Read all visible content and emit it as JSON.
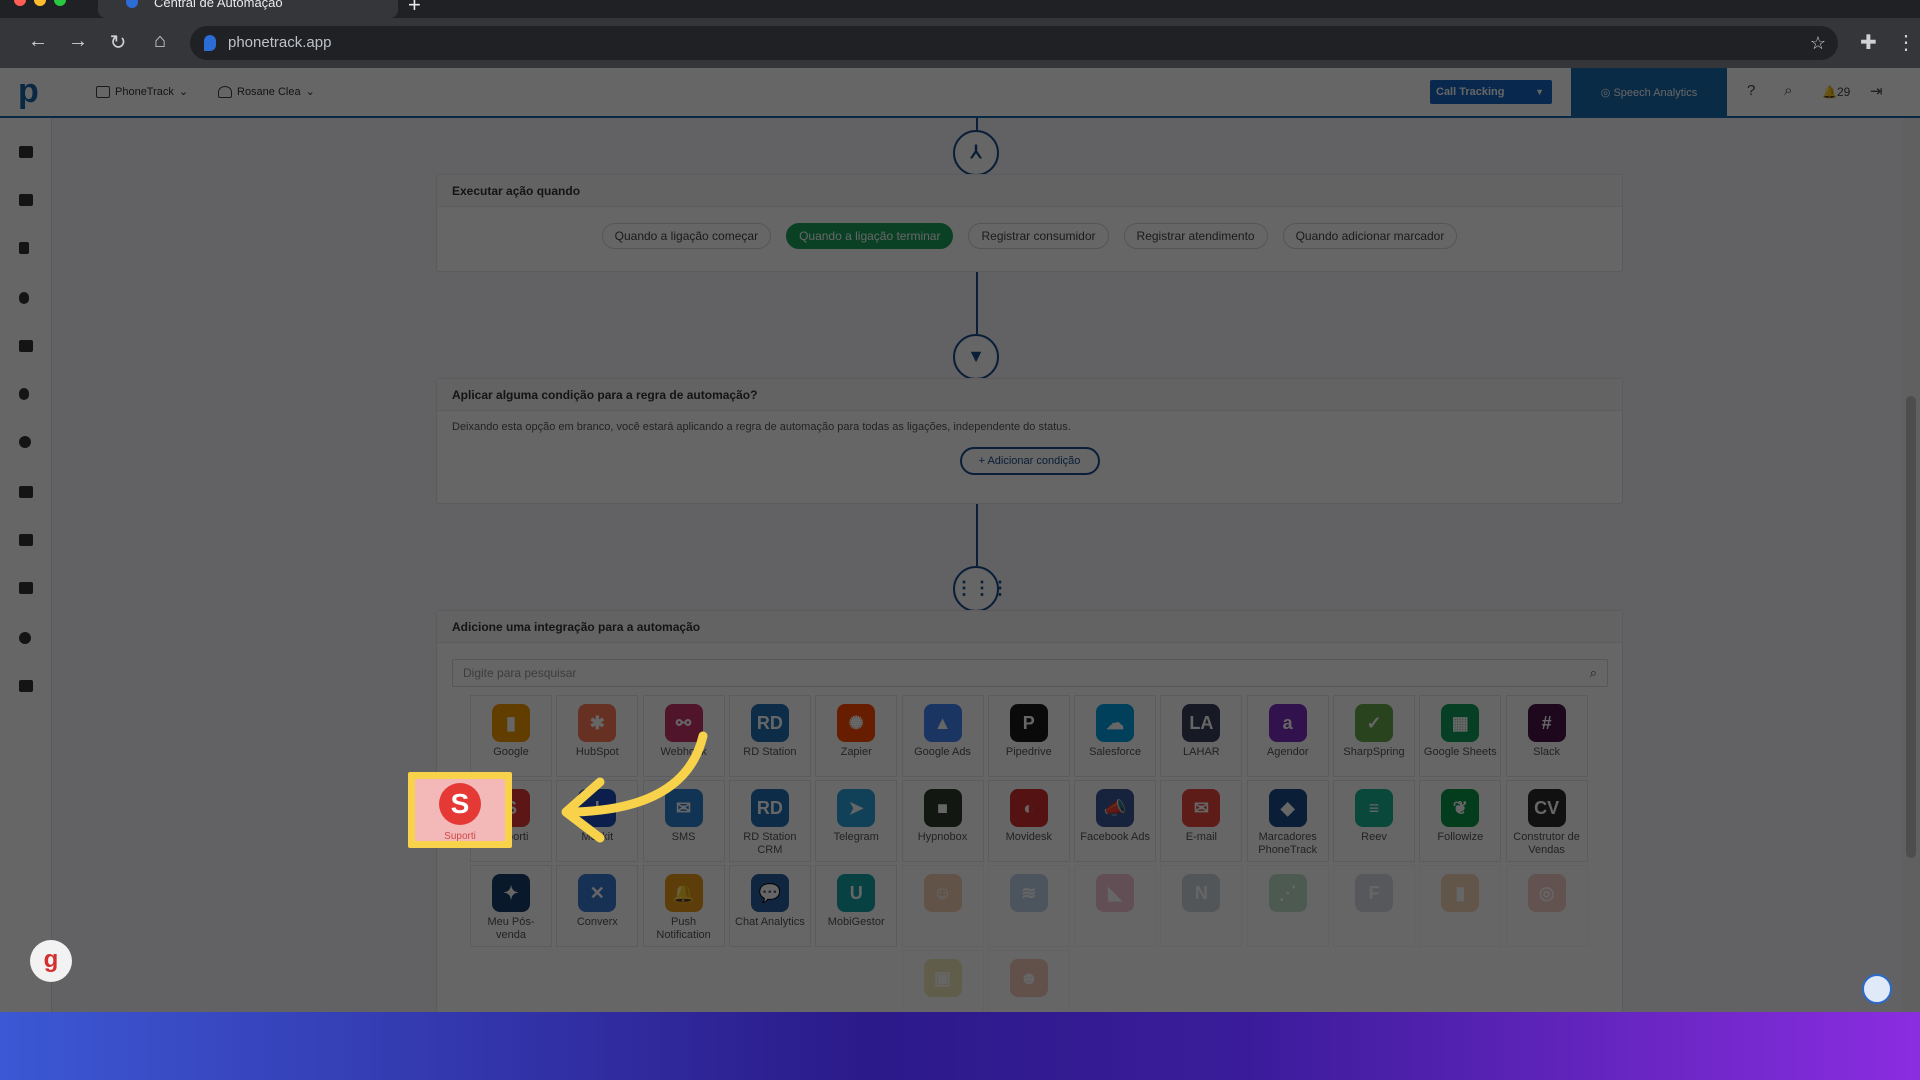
{
  "browser": {
    "tab_title": "Central de Automação",
    "url": "phonetrack.app",
    "new_tab": "+"
  },
  "header": {
    "menu_company": "PhoneTrack",
    "menu_user": "Rosane Clea",
    "call_tracking": "Call Tracking",
    "speech_analytics": "Speech Analytics",
    "notifications_count": "29"
  },
  "trigger": {
    "title": "Executar ação quando",
    "options": [
      "Quando a ligação começar",
      "Quando a ligação terminar",
      "Registrar consumidor",
      "Registrar atendimento",
      "Quando adicionar marcador"
    ],
    "selected": "Quando a ligação terminar"
  },
  "condition": {
    "title": "Aplicar alguma condição para a regra de automação?",
    "description": "Deixando esta opção em branco, você estará aplicando a regra de automação para todas as ligações, independente do status.",
    "add_button": "Adicionar condição"
  },
  "integrations": {
    "title": "Adicione uma integração para a automação",
    "search_placeholder": "Digite para pesquisar",
    "tiles": [
      {
        "label": "Google",
        "color": "#f29900",
        "glyph": "▮"
      },
      {
        "label": "HubSpot",
        "color": "#ff7a59",
        "glyph": "✱"
      },
      {
        "label": "Webhook",
        "color": "#c9356b",
        "glyph": "⚯"
      },
      {
        "label": "RD Station",
        "color": "#1f6fb5",
        "glyph": "RD"
      },
      {
        "label": "Zapier",
        "color": "#ff4a00",
        "glyph": "✺"
      },
      {
        "label": "Google Ads",
        "color": "#4285f4",
        "glyph": "▲"
      },
      {
        "label": "Pipedrive",
        "color": "#1a1a1a",
        "glyph": "P"
      },
      {
        "label": "Salesforce",
        "color": "#00a1e0",
        "glyph": "☁"
      },
      {
        "label": "LAHAR",
        "color": "#3a3f5a",
        "glyph": "LA"
      },
      {
        "label": "Agendor",
        "color": "#7b2fbf",
        "glyph": "a"
      },
      {
        "label": "SharpSpring",
        "color": "#6aa84f",
        "glyph": "✓"
      },
      {
        "label": "Google Sheets",
        "color": "#0f9d58",
        "glyph": "▦"
      },
      {
        "label": "Slack",
        "color": "#4a154b",
        "glyph": "#"
      },
      {
        "label": "Suporti",
        "color": "#e53935",
        "glyph": "S"
      },
      {
        "label": "Moskit",
        "color": "#1f4fbf",
        "glyph": "!"
      },
      {
        "label": "SMS",
        "color": "#2b7fd1",
        "glyph": "✉"
      },
      {
        "label": "RD Station CRM",
        "color": "#1f6fb5",
        "glyph": "RD"
      },
      {
        "label": "Telegram",
        "color": "#2aa3de",
        "glyph": "➤"
      },
      {
        "label": "Hypnobox",
        "color": "#2f3a2f",
        "glyph": "■"
      },
      {
        "label": "Movidesk",
        "color": "#d32f2f",
        "glyph": "◐"
      },
      {
        "label": "Facebook Ads",
        "color": "#3b5998",
        "glyph": "📣"
      },
      {
        "label": "E-mail",
        "color": "#e8483d",
        "glyph": "✉"
      },
      {
        "label": "Marcadores PhoneTrack",
        "color": "#1a4c8b",
        "glyph": "◆"
      },
      {
        "label": "Reev",
        "color": "#1ab394",
        "glyph": "≡"
      },
      {
        "label": "Followize",
        "color": "#0a9a4a",
        "glyph": "❦"
      },
      {
        "label": "Construtor de Vendas",
        "color": "#2b2b2b",
        "glyph": "CV"
      },
      {
        "label": "Meu Pós-venda",
        "color": "#1a3d6b",
        "glyph": "✦"
      },
      {
        "label": "Converx",
        "color": "#3a7bd5",
        "glyph": "✕"
      },
      {
        "label": "Push Notification",
        "color": "#e89b1a",
        "glyph": "🔔"
      },
      {
        "label": "Chat Analytics",
        "color": "#2a5d9e",
        "glyph": "💬"
      },
      {
        "label": "MobiGestor",
        "color": "#13a3a3",
        "glyph": "U"
      },
      {
        "label": "",
        "color": "#e07a2c",
        "glyph": "☺"
      },
      {
        "label": "",
        "color": "#4a7fc1",
        "glyph": "≋"
      },
      {
        "label": "",
        "color": "#e05a8a",
        "glyph": "◣"
      },
      {
        "label": "",
        "color": "#7a8fa5",
        "glyph": "N"
      },
      {
        "label": "",
        "color": "#4aa86f",
        "glyph": "⋰"
      },
      {
        "label": "",
        "color": "#8fa0b5",
        "glyph": "F"
      },
      {
        "label": "",
        "color": "#e08a3a",
        "glyph": "▮"
      },
      {
        "label": "",
        "color": "#e07a6a",
        "glyph": "◎"
      },
      {
        "label": "",
        "color": "#d8c23a",
        "glyph": "▣"
      },
      {
        "label": "",
        "color": "#e36b3a",
        "glyph": "☻"
      }
    ],
    "highlighted": "Suporti"
  },
  "icons": {
    "node_trigger": "branch-icon",
    "node_condition": "filter-icon",
    "node_integration": "grid-icon"
  }
}
